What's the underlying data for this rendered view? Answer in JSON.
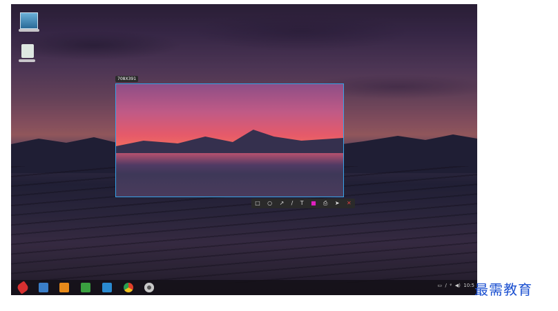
{
  "selection": {
    "size_label": "708X391"
  },
  "toolbar": {
    "tools": [
      {
        "name": "rect-tool-icon",
        "glyph": "□"
      },
      {
        "name": "ellipse-tool-icon",
        "glyph": "○"
      },
      {
        "name": "arrow-tool-icon",
        "glyph": "↗"
      },
      {
        "name": "pen-tool-icon",
        "glyph": "/"
      },
      {
        "name": "text-tool-icon",
        "glyph": "T"
      },
      {
        "name": "color-swatch",
        "glyph": "■"
      },
      {
        "name": "save-icon",
        "glyph": "⎙"
      },
      {
        "name": "share-icon",
        "glyph": "➤"
      },
      {
        "name": "close-icon",
        "glyph": "✕"
      }
    ],
    "color": "#e020c0"
  },
  "tray": {
    "time": "10:5"
  },
  "brand": {
    "text": "最需教育"
  }
}
